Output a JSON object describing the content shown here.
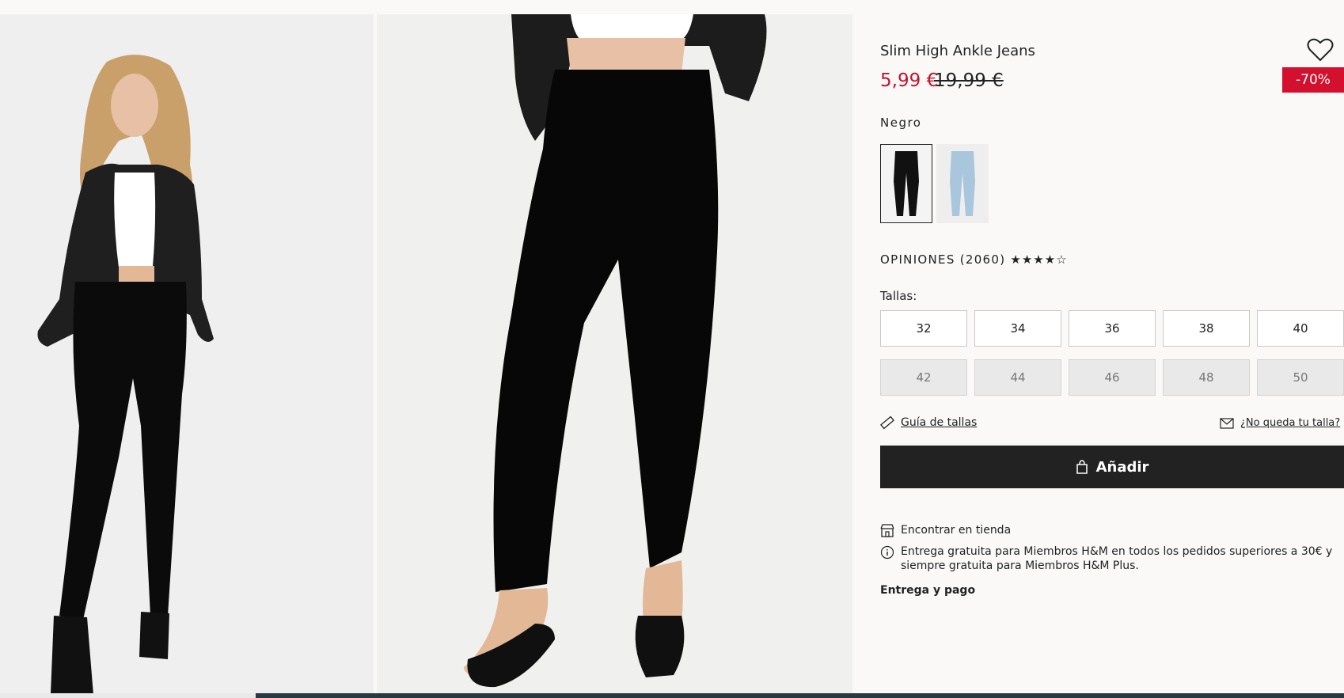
{
  "product": {
    "title": "Slim High Ankle Jeans",
    "price_sale": "5,99 €",
    "price_original": "19,99 €",
    "discount_badge": "-70%",
    "color_name": "Negro",
    "swatches": [
      "black-jeans",
      "light-blue-jeans"
    ],
    "reviews_label": "OPINIONES (2060)",
    "rating_stars": "★★★★☆",
    "rating": 4,
    "sizes_label": "Tallas:",
    "sizes": [
      {
        "label": "32",
        "available": true
      },
      {
        "label": "34",
        "available": true
      },
      {
        "label": "36",
        "available": true
      },
      {
        "label": "38",
        "available": true
      },
      {
        "label": "40",
        "available": true
      },
      {
        "label": "42",
        "available": false
      },
      {
        "label": "44",
        "available": false
      },
      {
        "label": "46",
        "available": false
      },
      {
        "label": "48",
        "available": false
      },
      {
        "label": "50",
        "available": false
      }
    ],
    "size_guide_link": "Guía de tallas",
    "size_missing_link": "¿No queda tu talla?",
    "add_button": "Añadir",
    "store_link": "Encontrar en tienda",
    "delivery_info": "Entrega gratuita para Miembros H&M en todos los pedidos superiores a 30€ y siempre gratuita para Miembros H&M Plus.",
    "delivery_link": "Entrega y pago"
  },
  "colors": {
    "sale": "#c4122f",
    "badge_bg": "#d3102e",
    "button_bg": "#222222"
  }
}
